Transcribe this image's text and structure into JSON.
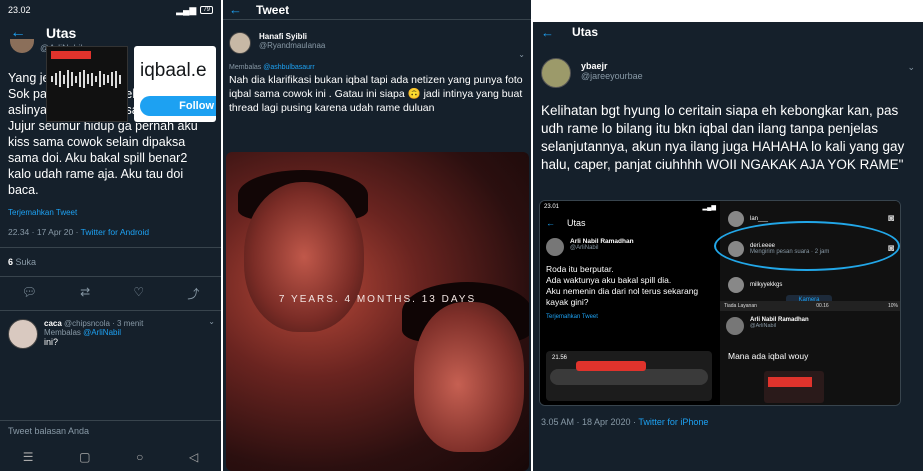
{
  "panel1": {
    "status": {
      "time": "23.02",
      "battery": "79"
    },
    "title": "Utas",
    "handle": "@ArliNabil",
    "tweet": "Yang jelas di gay!!\nSok pakboi cinlok dibeberapa film aslinya ga sukaa tuh sama cewek. Jujur seumur hidup ga pernah aku kiss sama cowok selain dipaksa sama doi. Aku bakal spill benar2 kalo udah rame aja. Aku tau doi baca.",
    "translate": "Terjemahkan Tweet",
    "time": "22.34 · 17 Apr 20 · ",
    "source": "Twitter for Android",
    "likes_count": "6",
    "likes_label": " Suka",
    "reply": {
      "name": "caca",
      "handle": " @chipsncola · 3 menit",
      "replying_prefix": "Membalas ",
      "replying_to": "@ArliNabil",
      "text": "ini?",
      "thumb_text": "iqbaal.e",
      "follow": "Follow"
    },
    "reply_box": "Tweet balasan Anda"
  },
  "panel2": {
    "title": "Tweet",
    "name": "Hanafi Syibli",
    "handle": "@Ryandmaulanaa",
    "replying_prefix": "Membalas ",
    "replying_to": "@ashbulbasaurr",
    "tweet": "Nah dia klarifikasi bukan iqbal tapi ada netizen yang punya foto iqbal sama cowok ini . Gatau ini siapa 🙃 jadi intinya yang buat thread lagi pusing karena udah rame duluan",
    "photo_caption": "7 YEARS. 4 MONTHS. 13 DAYS"
  },
  "panel3": {
    "title": "Utas",
    "name": "ybaejr",
    "handle": "@jareeyourbae",
    "tweet": "Kelihatan bgt hyung lo ceritain siapa eh kebongkar kan, pas udh rame lo bilang itu bkn iqbal dan ilang tanpa penjelas selanjutannya, akun nya ilang juga HAHAHA lo kali yang gay halu, caper, panjat ciuhhhh WOII NGAKAK AJA YOK RAME\"",
    "time": "3.05 AM · 18 Apr 2020 · ",
    "source": "Twitter for iPhone",
    "embedded_left": {
      "status_time": "23.01",
      "title": "Utas",
      "name": "Arli Nabil Ramadhan",
      "handle": "@ArliNabil",
      "tweet": "Roda itu berputar.\nAda waktunya aku bakal spill dia.\nAku nemenin dia dari nol terus sekarang kayak gini?",
      "translate": "Terjemahkan Tweet",
      "bottom_time": "21.56"
    },
    "embedded_right": {
      "rows": [
        {
          "name": "lan___"
        },
        {
          "name": "deri.eeee",
          "sub": "Mengirim pesan suara · 2 jam"
        },
        {
          "name": "milkyyekkgs"
        }
      ],
      "notif_left": "Tiada Layanan",
      "notif_mid": "00.16",
      "notif_right": "10%",
      "camera": "Kamera",
      "name": "Arli Nabil Ramadhan",
      "handle": "@ArliNabil",
      "text": "Mana ada iqbal wouy"
    }
  }
}
